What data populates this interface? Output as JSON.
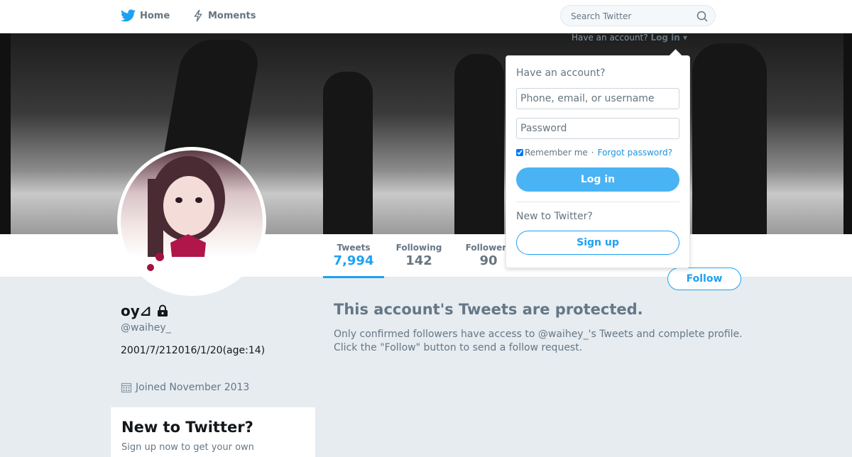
{
  "nav": {
    "home_label": "Home",
    "moments_label": "Moments",
    "search_placeholder": "Search Twitter",
    "have_account": "Have an account?",
    "login_link": "Log in"
  },
  "profile": {
    "name": "oy⊿",
    "handle": "@waihey_",
    "bio": "2001/7/212016/1/20(age:14)",
    "joined": "Joined November 2013"
  },
  "stats": [
    {
      "label": "Tweets",
      "value": "7,994"
    },
    {
      "label": "Following",
      "value": "142"
    },
    {
      "label": "Followers",
      "value": "90"
    }
  ],
  "follow_label": "Follow",
  "protected": {
    "title": "This account's Tweets are protected.",
    "text": "Only confirmed followers have access to @waihey_'s Tweets and complete profile. Click the \"Follow\" button to send a follow request."
  },
  "sidebar_card": {
    "title": "New to Twitter?",
    "text": "Sign up now to get your own"
  },
  "login_dropdown": {
    "title": "Have an account?",
    "username_placeholder": "Phone, email, or username",
    "password_placeholder": "Password",
    "remember_label": "Remember me",
    "separator": "·",
    "forgot_label": "Forgot password?",
    "login_button": "Log in",
    "new_label": "New to Twitter?",
    "signup_button": "Sign up"
  },
  "colors": {
    "accent": "#1da1f2",
    "login_button": "#4ab3f4",
    "background": "#e6ecf0"
  }
}
